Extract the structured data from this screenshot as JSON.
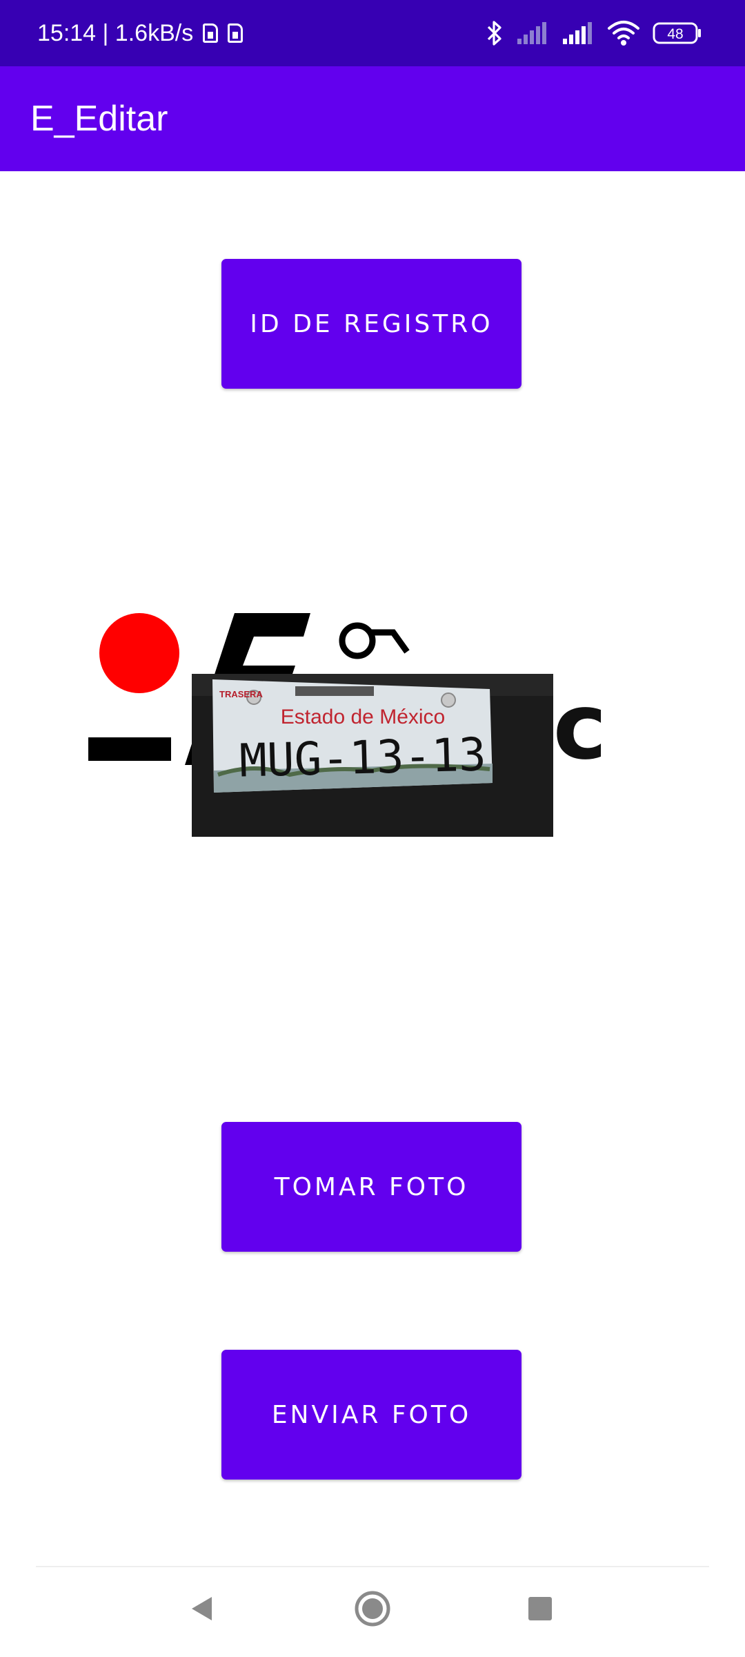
{
  "status_bar": {
    "time_speed": "15:14 | 1.6kB/s",
    "battery_level": "48",
    "icons": [
      "sim-card-icon",
      "sim-card-icon",
      "bluetooth-icon",
      "signal-icon",
      "signal-icon",
      "wifi-icon",
      "battery-icon"
    ]
  },
  "app_bar": {
    "title": "E_Editar"
  },
  "buttons": {
    "id_registro": "ID DE REGISTRO",
    "tomar_foto": "TOMAR FOTO",
    "enviar_foto": "ENVIAR FOTO"
  },
  "photo": {
    "logo_text": "ec",
    "plate_header": "Estado de México",
    "plate_corner": "TRASERA",
    "plate_number": "MUG-13-13"
  },
  "nav_bar": {
    "icons": [
      "back-icon",
      "home-icon",
      "recents-icon"
    ]
  },
  "colors": {
    "status_bar": "#3700B3",
    "primary": "#6200EE",
    "on_primary": "#FFFFFF"
  }
}
